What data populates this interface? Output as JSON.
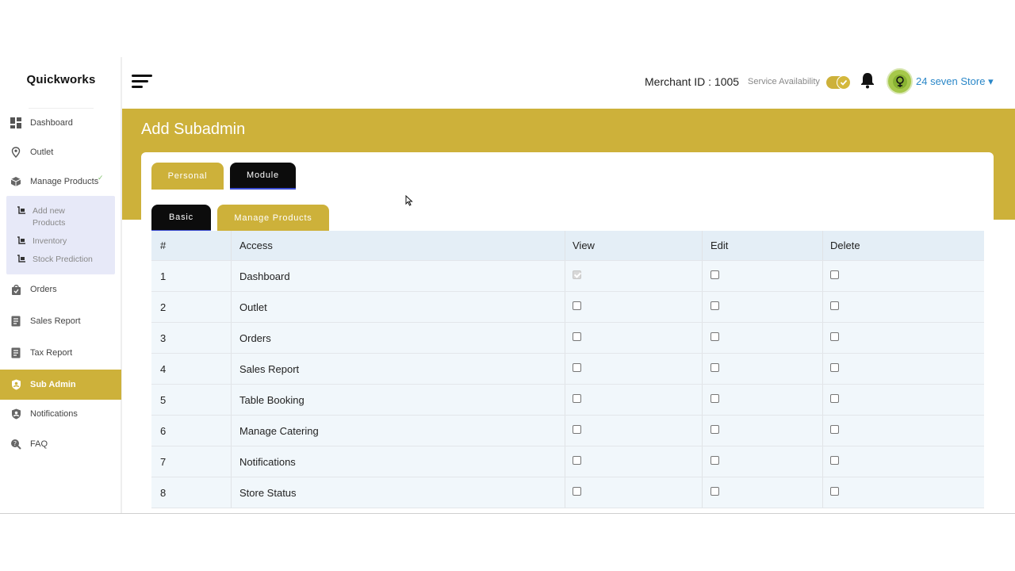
{
  "app": {
    "logo": "Quickworks"
  },
  "sidebar": {
    "items": [
      {
        "label": "Dashboard",
        "icon": "dashboard-icon"
      },
      {
        "label": "Outlet",
        "icon": "map-pin-icon"
      },
      {
        "label": "Manage Products",
        "icon": "box-icon"
      },
      {
        "label": "Orders",
        "icon": "bag-icon"
      },
      {
        "label": "Sales Report",
        "icon": "report-icon"
      },
      {
        "label": "Tax Report",
        "icon": "report-icon"
      },
      {
        "label": "Sub Admin",
        "icon": "shield-user-icon"
      },
      {
        "label": "Notifications",
        "icon": "shield-icon"
      },
      {
        "label": "FAQ",
        "icon": "faq-icon"
      }
    ],
    "submenu": [
      {
        "label": "Add new Products"
      },
      {
        "label": "Inventory"
      },
      {
        "label": "Stock Prediction"
      }
    ],
    "active": "Sub Admin"
  },
  "header": {
    "merchant": "Merchant ID : 1005",
    "service_label": "Service Availability",
    "service_on": true,
    "store_name": "24 seven Store",
    "store_caret": "▾"
  },
  "page": {
    "title": "Add Subadmin",
    "tabs": [
      "Personal",
      "Module"
    ],
    "subtabs": [
      "Basic",
      "Manage Products"
    ]
  },
  "table": {
    "headers": [
      "#",
      "Access",
      "View",
      "Edit",
      "Delete"
    ],
    "rows": [
      {
        "num": "1",
        "access": "Dashboard",
        "view": true,
        "view_disabled": true,
        "edit": false,
        "delete": false
      },
      {
        "num": "2",
        "access": "Outlet",
        "view": false,
        "edit": false,
        "delete": false
      },
      {
        "num": "3",
        "access": "Orders",
        "view": false,
        "edit": false,
        "delete": false
      },
      {
        "num": "4",
        "access": "Sales Report",
        "view": false,
        "edit": false,
        "delete": false
      },
      {
        "num": "5",
        "access": "Table Booking",
        "view": false,
        "edit": false,
        "delete": false
      },
      {
        "num": "6",
        "access": "Manage Catering",
        "view": false,
        "edit": false,
        "delete": false
      },
      {
        "num": "7",
        "access": "Notifications",
        "view": false,
        "edit": false,
        "delete": false
      },
      {
        "num": "8",
        "access": "Store Status",
        "view": false,
        "edit": false,
        "delete": false
      }
    ]
  },
  "colors": {
    "accent": "#cdb13a",
    "link": "#2a87c8",
    "dark": "#0c0c0c"
  }
}
